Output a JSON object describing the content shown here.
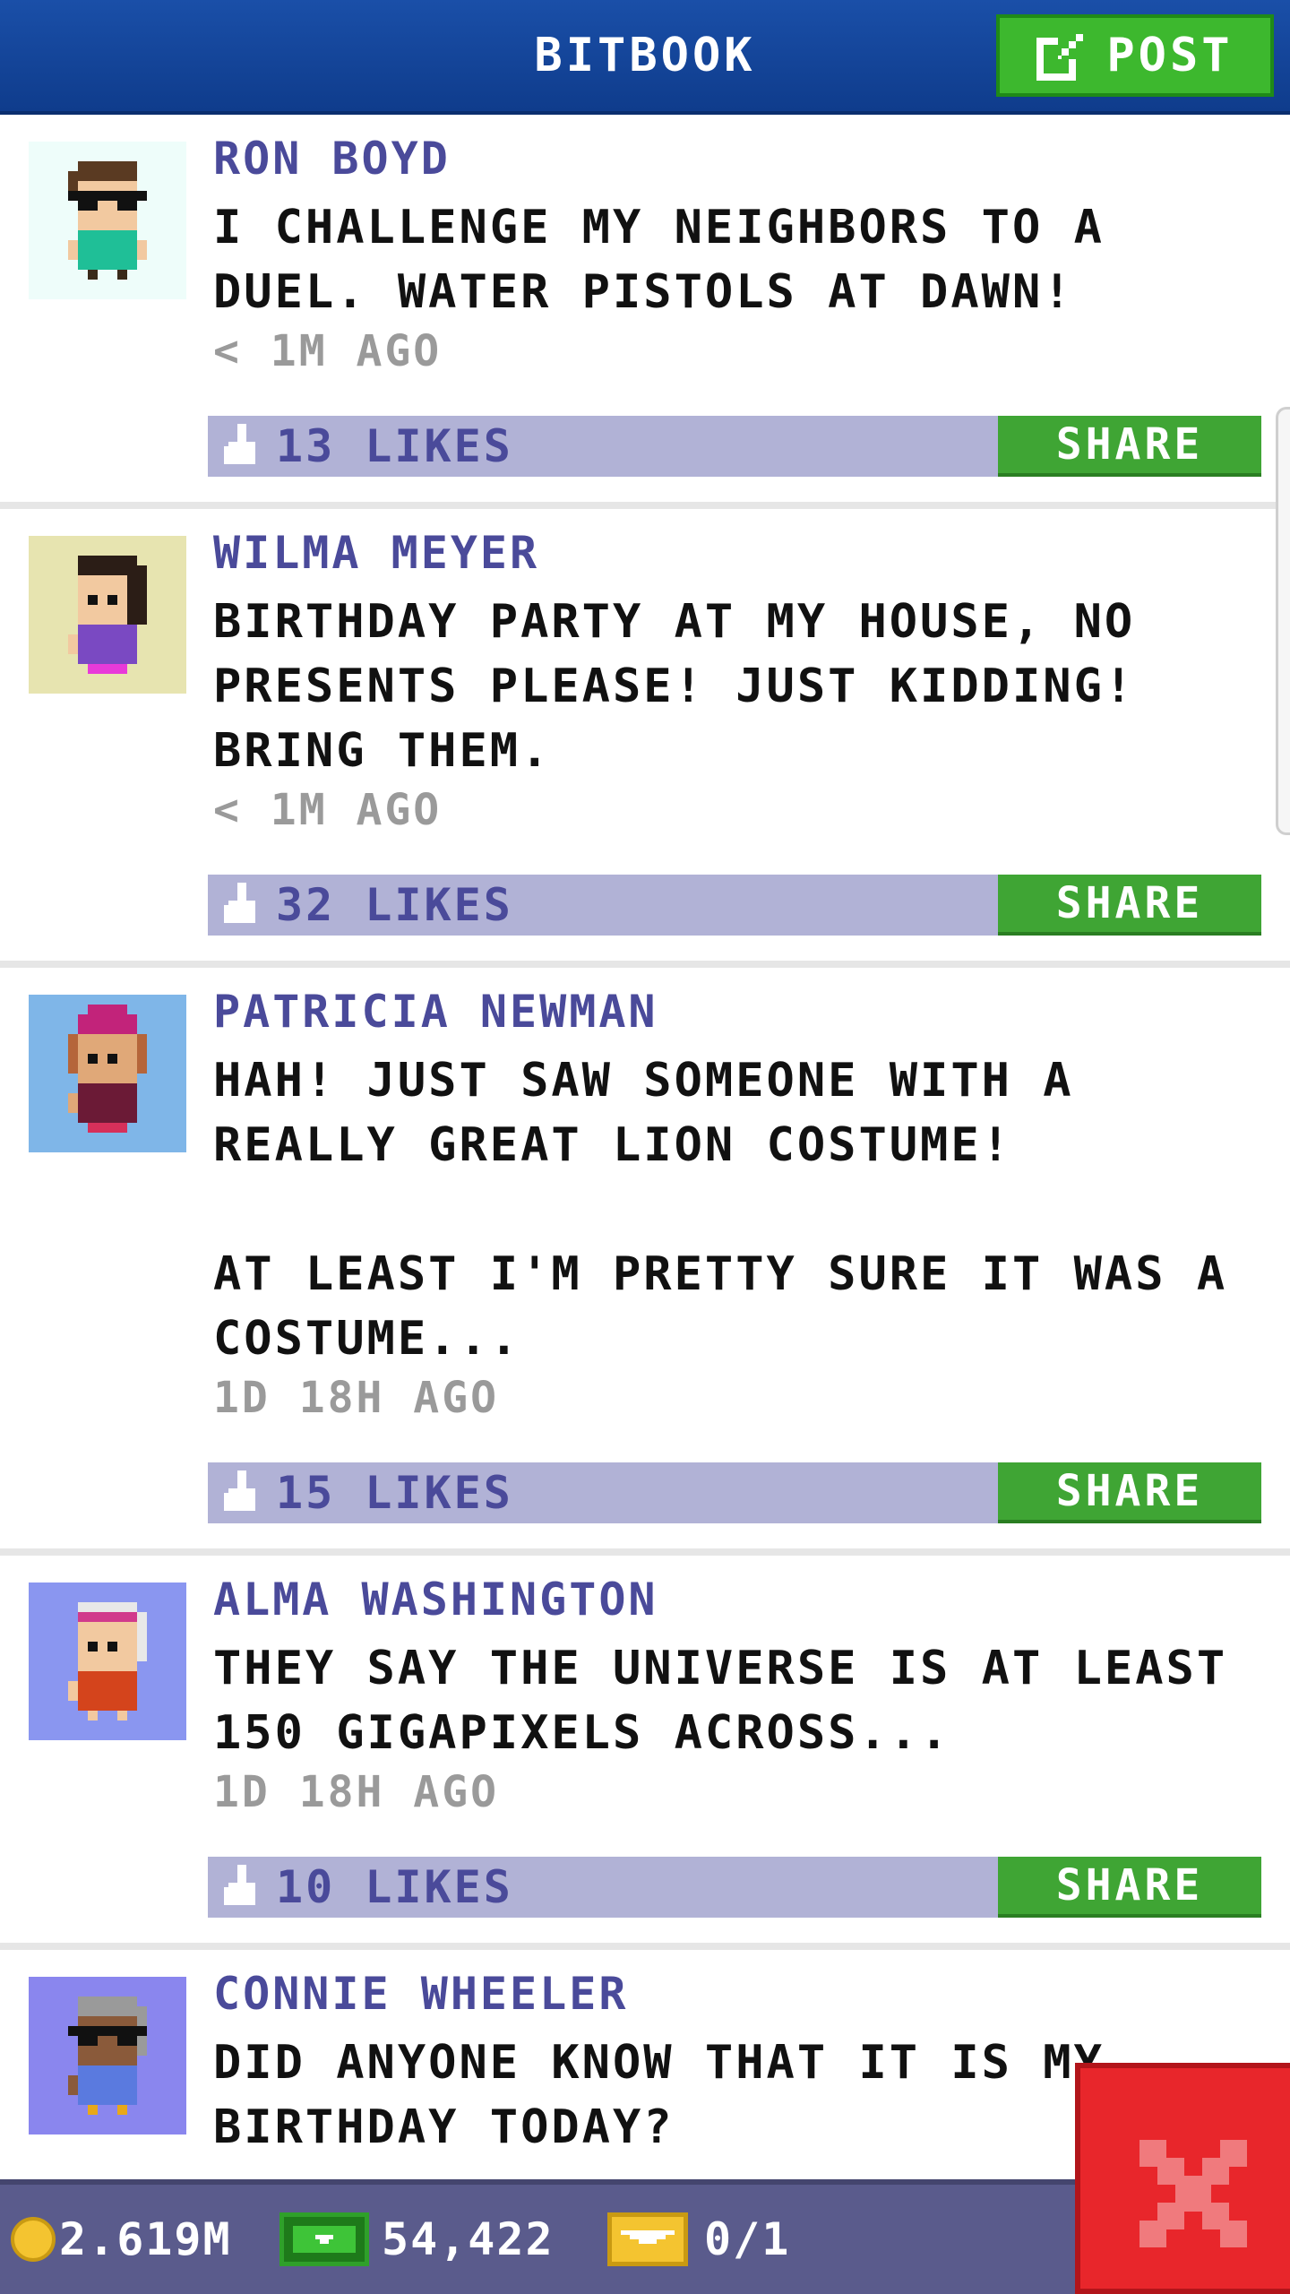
{
  "header": {
    "title": "BITBOOK",
    "post_label": "POST"
  },
  "colors": {
    "header_blue": "#1a4fa8",
    "button_green": "#3fa534",
    "like_bar": "#b1b2d6",
    "author_purple": "#4a4a9a",
    "close_red": "#e8262b"
  },
  "posts": [
    {
      "author": "RON BOYD",
      "text": "I CHALLENGE MY NEIGHBORS TO A\nDUEL. WATER PISTOLS AT DAWN!",
      "time": "< 1M AGO",
      "likes": "13 LIKES",
      "share_label": "SHARE",
      "avatar_bg": "#eefdfa",
      "avatar_icon": "man-with-sunglasses-avatar"
    },
    {
      "author": "WILMA MEYER",
      "text": "BIRTHDAY PARTY AT MY HOUSE, NO\nPRESENTS PLEASE! JUST KIDDING!\nBRING THEM.",
      "time": "< 1M AGO",
      "likes": "32 LIKES",
      "share_label": "SHARE",
      "avatar_bg": "#e7e4b0",
      "avatar_icon": "woman-dark-hair-avatar"
    },
    {
      "author": "PATRICIA NEWMAN",
      "text": "HAH! JUST SAW SOMEONE WITH A\nREALLY GREAT LION COSTUME!\n\nAT LEAST I'M PRETTY SURE IT WAS A\nCOSTUME...",
      "time": "1D 18H AGO",
      "likes": "15 LIKES",
      "share_label": "SHARE",
      "avatar_bg": "#7fb6e8",
      "avatar_icon": "woman-pink-hat-avatar"
    },
    {
      "author": "ALMA WASHINGTON",
      "text": "THEY SAY THE UNIVERSE IS AT LEAST\n150 GIGAPIXELS ACROSS...",
      "time": "1D 18H AGO",
      "likes": "10 LIKES",
      "share_label": "SHARE",
      "avatar_bg": "#8a96f0",
      "avatar_icon": "woman-headband-avatar"
    },
    {
      "author": "CONNIE WHEELER",
      "text": "DID ANYONE KNOW THAT IT IS MY\nBIRTHDAY TODAY?",
      "time": "",
      "likes": "",
      "share_label": "",
      "avatar_bg": "#8a86ee",
      "avatar_icon": "woman-gray-hair-sunglasses-avatar"
    }
  ],
  "bottom_bar": {
    "coins": "2.619M",
    "bux": "54,422",
    "tickets": "0/1"
  },
  "close_icon": "close-x-icon"
}
